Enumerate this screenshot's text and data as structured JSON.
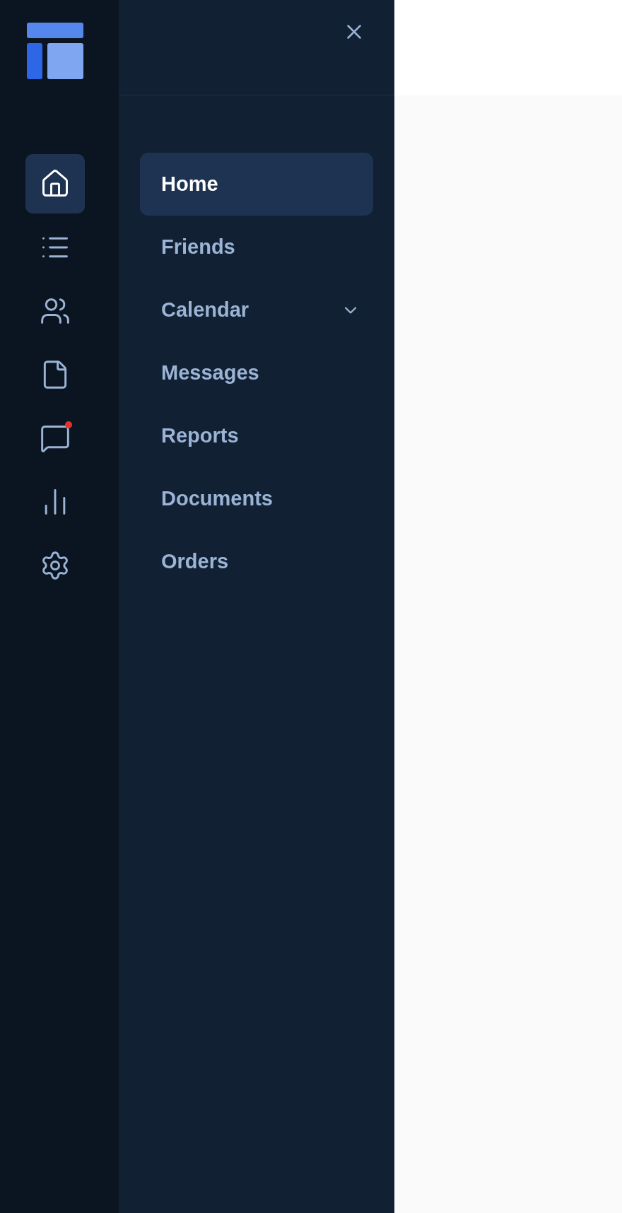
{
  "icon_rail": [
    {
      "kind": "home",
      "selected": true,
      "badge": false
    },
    {
      "kind": "list",
      "selected": false,
      "badge": false
    },
    {
      "kind": "users",
      "selected": false,
      "badge": false
    },
    {
      "kind": "file",
      "selected": false,
      "badge": false
    },
    {
      "kind": "chat",
      "selected": false,
      "badge": true
    },
    {
      "kind": "chart",
      "selected": false,
      "badge": false
    },
    {
      "kind": "settings",
      "selected": false,
      "badge": false
    }
  ],
  "menu": [
    {
      "label": "Home",
      "selected": true,
      "expandable": false
    },
    {
      "label": "Friends",
      "selected": false,
      "expandable": false
    },
    {
      "label": "Calendar",
      "selected": false,
      "expandable": true
    },
    {
      "label": "Messages",
      "selected": false,
      "expandable": false
    },
    {
      "label": "Reports",
      "selected": false,
      "expandable": false
    },
    {
      "label": "Documents",
      "selected": false,
      "expandable": false
    },
    {
      "label": "Orders",
      "selected": false,
      "expandable": false
    }
  ]
}
